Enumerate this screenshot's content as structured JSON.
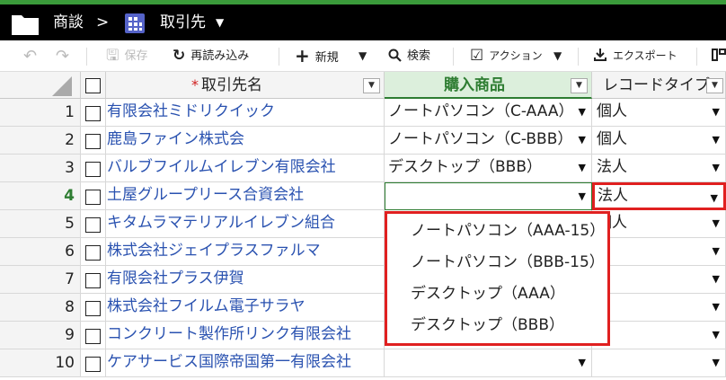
{
  "header": {
    "app": "商談",
    "separator": ">",
    "view": "取引先",
    "view_caret": "▼",
    "colors": {
      "bar": "#000000",
      "accent_line": "#3a9a3a",
      "view_icon": "#5563c8"
    }
  },
  "toolbar": {
    "undo": "↶",
    "redo": "↷",
    "save": "保存",
    "reload": "再読み込み",
    "new": "新規",
    "new_caret": "▼",
    "search": "検索",
    "action": "アクション",
    "action_caret": "▼",
    "export": "エクスポート"
  },
  "columns": {
    "required_mark": "*",
    "name": "取引先名",
    "product": "購入商品",
    "type": "レコードタイプ",
    "filter_glyph": "▼"
  },
  "rows": [
    {
      "num": "1",
      "name": "有限会社ミドリクイック",
      "product": "ノートパソコン（C-AAA）",
      "type": "個人"
    },
    {
      "num": "2",
      "name": "鹿島ファイン株式会",
      "product": "ノートパソコン（C-BBB）",
      "type": "個人"
    },
    {
      "num": "3",
      "name": "バルブフイルムイレブン有限会社",
      "product": "デスクトップ（BBB）",
      "type": "法人"
    },
    {
      "num": "4",
      "name": "土屋グループリース合資会社",
      "product": "",
      "type": "法人"
    },
    {
      "num": "5",
      "name": "キタムラマテリアルイレブン組合",
      "product": "",
      "type": "個人"
    },
    {
      "num": "6",
      "name": "株式会社ジェイプラスファルマ",
      "product": "",
      "type": ""
    },
    {
      "num": "7",
      "name": "有限会社プラス伊賀",
      "product": "",
      "type": ""
    },
    {
      "num": "8",
      "name": "株式会社フイルム電子サラヤ",
      "product": "",
      "type": ""
    },
    {
      "num": "9",
      "name": "コンクリート製作所リンク有限会社",
      "product": "",
      "type": ""
    },
    {
      "num": "10",
      "name": "ケアサービス国際帝国第一有限会社",
      "product": "",
      "type": ""
    }
  ],
  "cell_arrow": "▼",
  "dropdown": {
    "options": [
      "ノートパソコン（AAA-15）",
      "ノートパソコン（BBB-15）",
      "デスクトップ（AAA）",
      "デスクトップ（BBB）"
    ]
  }
}
